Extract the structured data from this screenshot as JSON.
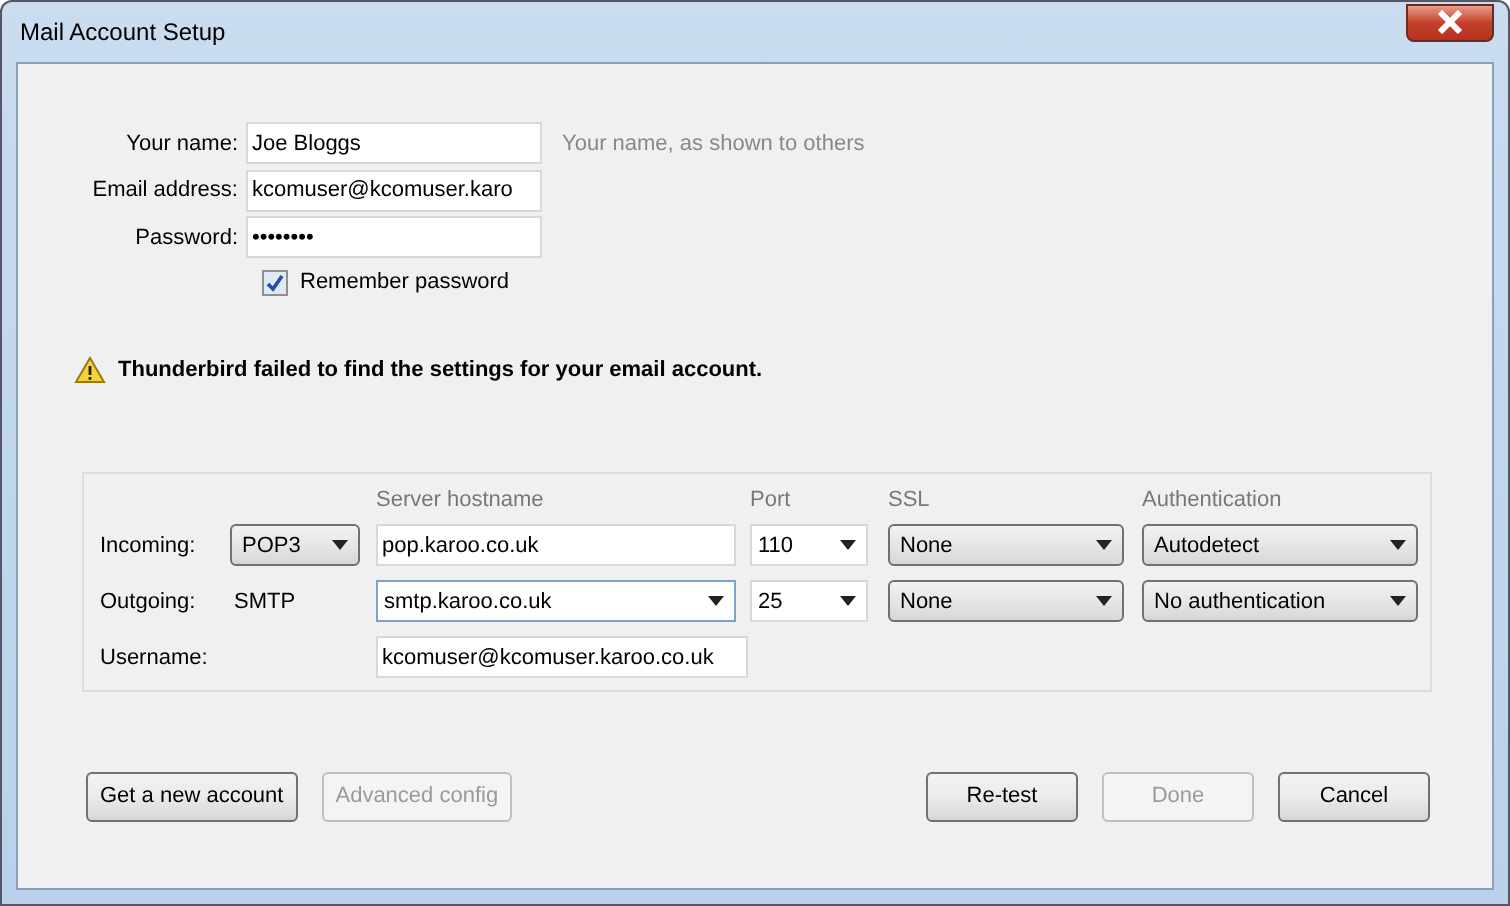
{
  "window": {
    "title": "Mail Account Setup"
  },
  "identity": {
    "fields": [
      {
        "label": "Your name:",
        "value": "Joe Bloggs",
        "hint": "Your name, as shown to others"
      },
      {
        "label": "Email address:",
        "value": "kcomuser@kcomuser.karo"
      },
      {
        "label": "Password:",
        "value": "••••••••"
      }
    ],
    "remember_password": {
      "label": "Remember password",
      "checked": true
    }
  },
  "warning": "Thunderbird failed to find the settings for your email account.",
  "servers": {
    "columns": [
      "Server hostname",
      "Port",
      "SSL",
      "Authentication"
    ],
    "rows": [
      {
        "label": "Incoming:",
        "protocol": {
          "kind": "dropdown",
          "value": "POP3"
        },
        "hostname": {
          "kind": "text",
          "value": "pop.karoo.co.uk"
        },
        "port": "110",
        "ssl": "None",
        "authentication": "Autodetect"
      },
      {
        "label": "Outgoing:",
        "protocol": {
          "kind": "text",
          "value": "SMTP"
        },
        "hostname": {
          "kind": "combo",
          "value": "smtp.karoo.co.uk"
        },
        "port": "25",
        "ssl": "None",
        "authentication": "No authentication"
      }
    ],
    "username": {
      "label": "Username:",
      "value": "kcomuser@kcomuser.karoo.co.uk"
    }
  },
  "buttons_left": [
    {
      "label": "Get a new account",
      "disabled": false
    },
    {
      "label": "Advanced config",
      "disabled": true
    }
  ],
  "buttons_right": [
    {
      "label": "Re-test",
      "disabled": false
    },
    {
      "label": "Done",
      "disabled": true
    },
    {
      "label": "Cancel",
      "disabled": false
    }
  ]
}
